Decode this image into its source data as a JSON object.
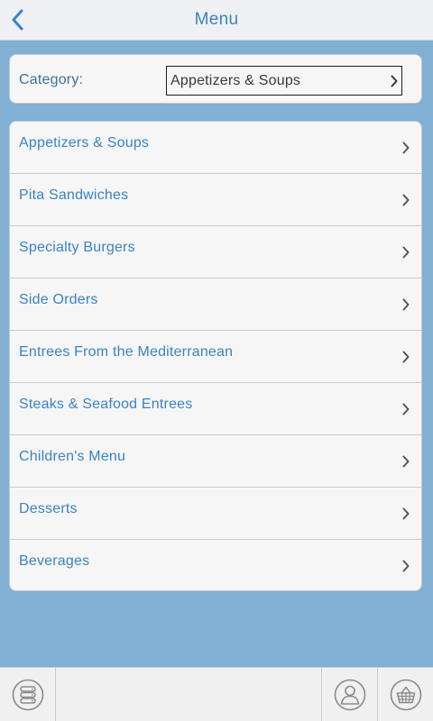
{
  "header": {
    "title": "Menu",
    "back_icon": "chevron-left-icon"
  },
  "category": {
    "label": "Category:",
    "selected": "Appetizers & Soups"
  },
  "menu_items": [
    {
      "label": "Appetizers & Soups"
    },
    {
      "label": "Pita Sandwiches"
    },
    {
      "label": "Specialty Burgers"
    },
    {
      "label": "Side Orders"
    },
    {
      "label": "Entrees From the Mediterranean"
    },
    {
      "label": "Steaks & Seafood Entrees"
    },
    {
      "label": "Children's Menu"
    },
    {
      "label": "Desserts"
    },
    {
      "label": "Beverages"
    }
  ],
  "toolbar": {
    "left_icon": "database-icon",
    "right_icons": [
      "user-icon",
      "basket-icon"
    ]
  },
  "colors": {
    "background": "#82afd4",
    "accent": "#3a83c4",
    "header_bg": "#eef0f3",
    "card_bg": "#f6f6f6",
    "icon_gray": "#8a8a8a"
  }
}
